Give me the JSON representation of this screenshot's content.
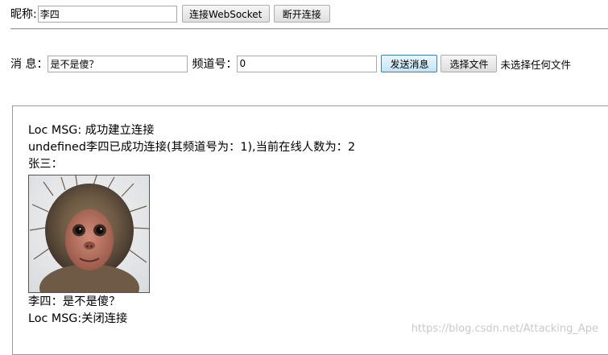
{
  "connect_row": {
    "nickname_label": "昵称:",
    "nickname_value": "李四",
    "connect_button": "连接WebSocket",
    "disconnect_button": "断开连接"
  },
  "message_row": {
    "message_label": "消 息：",
    "message_value": "是不是傻？",
    "channel_label": "频道号：",
    "channel_value": "0",
    "send_button": "发送消息",
    "choose_file_button": "选择文件",
    "file_status": "未选择任何文件"
  },
  "messages": {
    "line1": "Loc MSG: 成功建立连接",
    "line2": "undefined李四已成功连接(其频道号为：1),当前在线人数为：2",
    "line3": "张三：",
    "image_icon": "monkey-photo",
    "line4": "李四：是不是傻？",
    "line5": "Loc MSG:关闭连接"
  },
  "watermark": "https://blog.csdn.net/Attacking_Ape"
}
